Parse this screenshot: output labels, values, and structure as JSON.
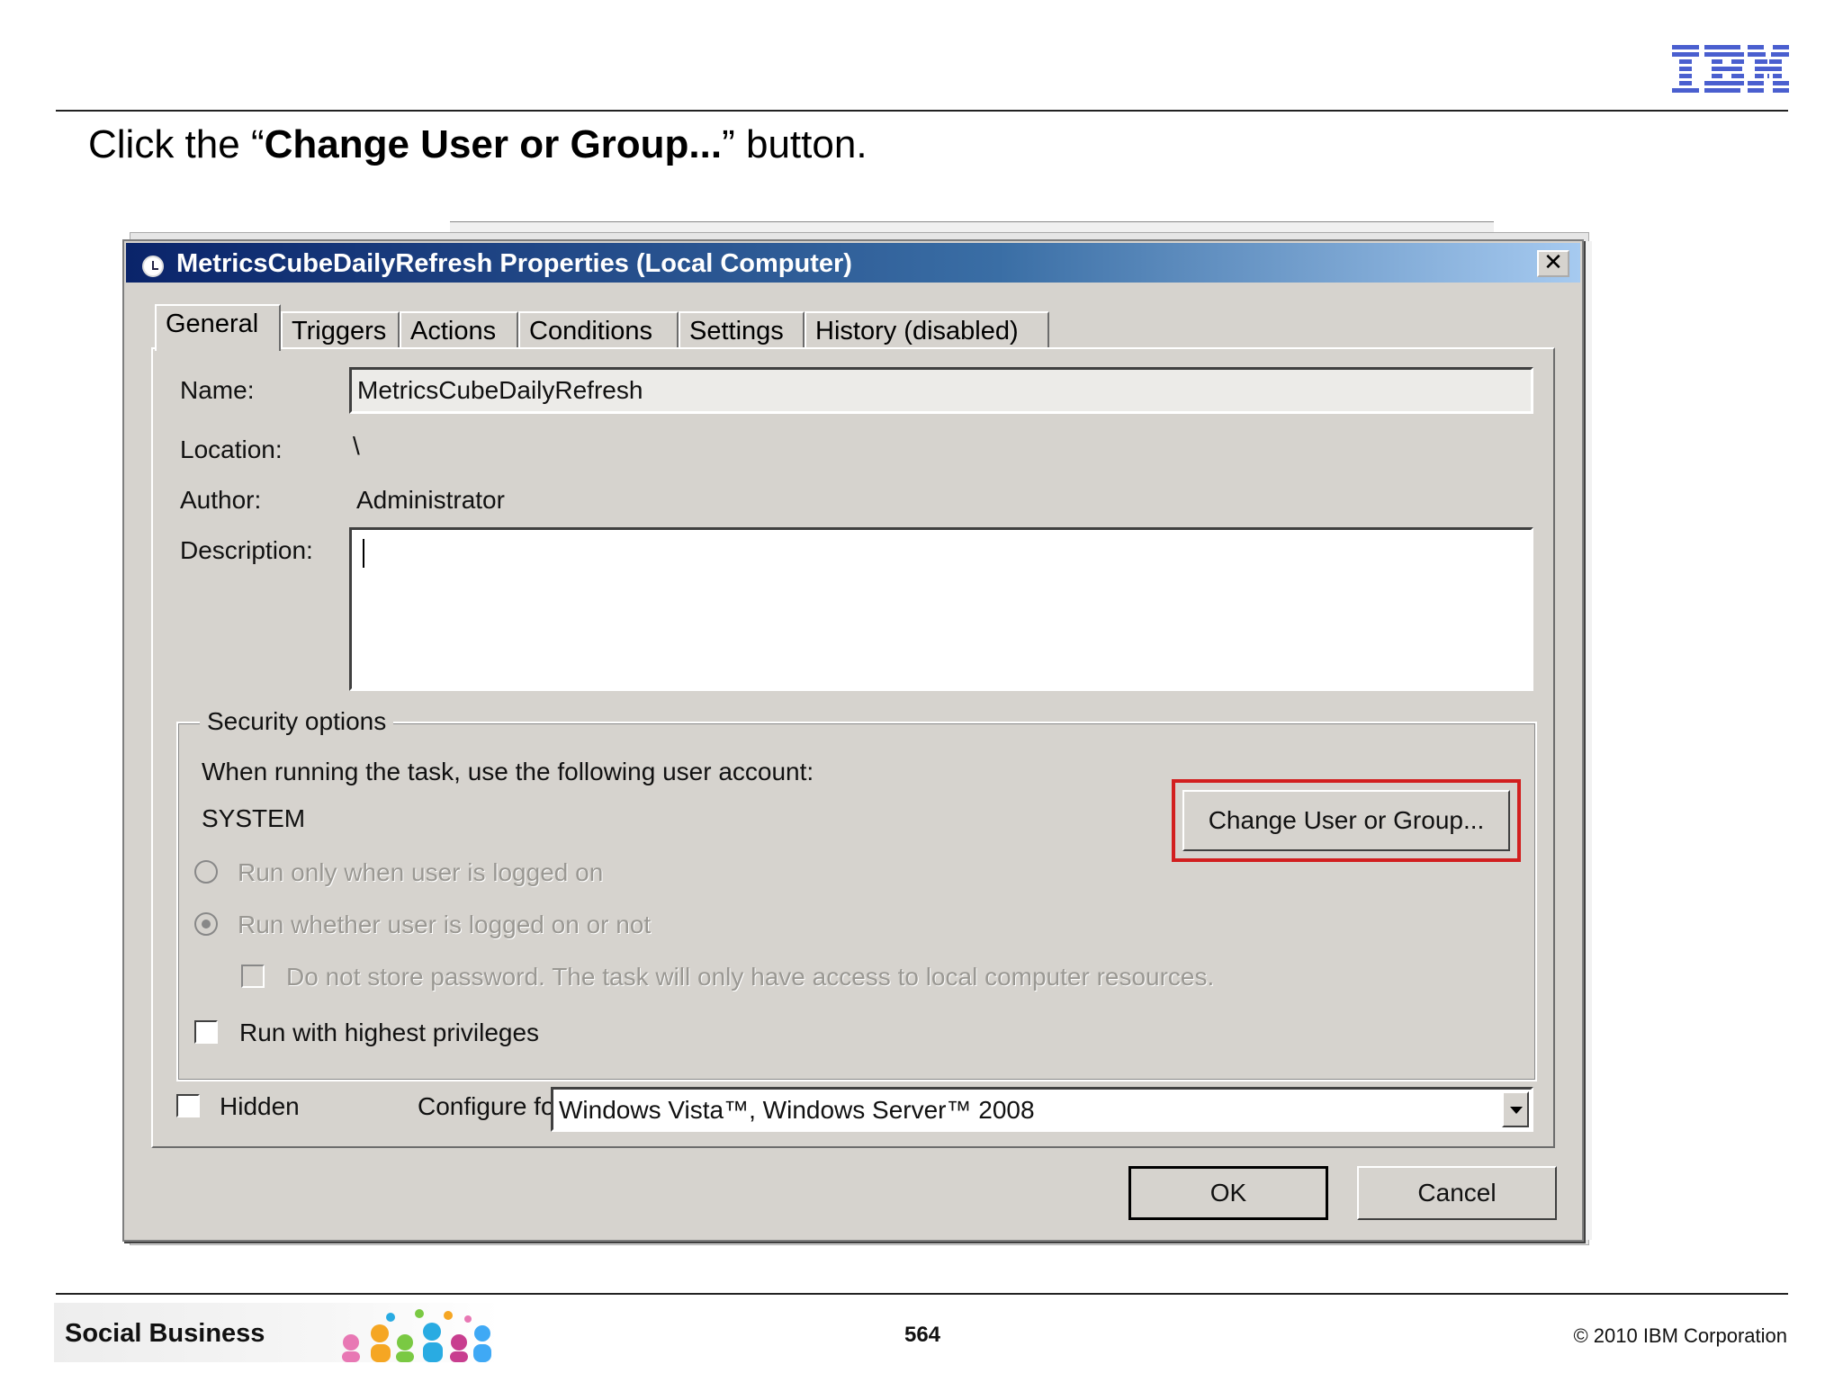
{
  "slide": {
    "logo_text": "IBM",
    "instruction_pre": "Click the “",
    "instruction_bold": "Change User or Group...",
    "instruction_post": "” button.",
    "footer_brand": "Social Business",
    "page_number": "564",
    "copyright": "© 2010 IBM Corporation"
  },
  "dialog": {
    "title": "MetricsCubeDailyRefresh Properties (Local Computer)",
    "close_label": "✕",
    "tabs": [
      {
        "label": "General",
        "active": true
      },
      {
        "label": "Triggers"
      },
      {
        "label": "Actions"
      },
      {
        "label": "Conditions"
      },
      {
        "label": "Settings"
      },
      {
        "label": "History (disabled)"
      }
    ],
    "general": {
      "name_label": "Name:",
      "name_value": "MetricsCubeDailyRefresh",
      "location_label": "Location:",
      "location_value": "\\",
      "author_label": "Author:",
      "author_value": "Administrator",
      "description_label": "Description:",
      "description_value": ""
    },
    "security": {
      "legend": "Security options",
      "prompt": "When running the task, use the following user account:",
      "account": "SYSTEM",
      "change_button": "Change User or Group...",
      "radio_logged_on": "Run only when user is logged on",
      "radio_whether": "Run whether user is logged on or not",
      "no_store_password": "Do not store password.  The task will only have access to local computer resources.",
      "highest_privileges": "Run with highest privileges"
    },
    "hidden_label": "Hidden",
    "configure_label": "Configure for:",
    "configure_value": "Windows Vista™, Windows Server™ 2008",
    "ok_button": "OK",
    "cancel_button": "Cancel"
  },
  "colors": {
    "highlight": "#d21f1f",
    "title_gradient_start": "#0a246a",
    "ibm_blue": "#4a5fcf"
  }
}
